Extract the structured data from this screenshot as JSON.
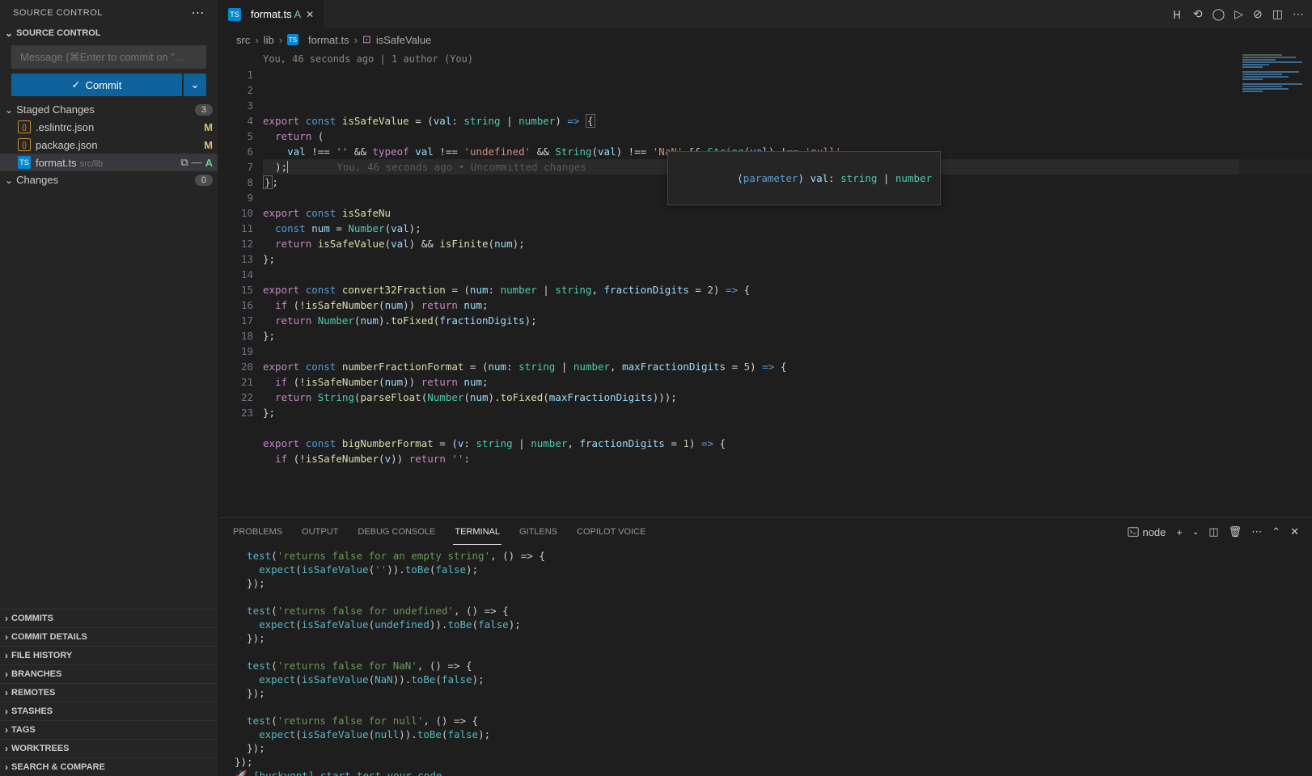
{
  "sidebar": {
    "title": "SOURCE CONTROL",
    "scm_header": "SOURCE CONTROL",
    "message_placeholder": "Message (⌘Enter to commit on \"...",
    "commit_label": "Commit",
    "staged_label": "Staged Changes",
    "staged_count": "3",
    "changes_label": "Changes",
    "changes_count": "0",
    "staged_files": [
      {
        "name": ".eslintrc.json",
        "status": "M",
        "icon": "json"
      },
      {
        "name": "package.json",
        "status": "M",
        "icon": "json"
      },
      {
        "name": "format.ts",
        "path": "src/lib",
        "status": "A",
        "icon": "ts",
        "selected": true
      }
    ],
    "other_sections": [
      "COMMITS",
      "COMMIT DETAILS",
      "FILE HISTORY",
      "BRANCHES",
      "REMOTES",
      "STASHES",
      "TAGS",
      "WORKTREES",
      "SEARCH & COMPARE"
    ]
  },
  "tab": {
    "title": "format.ts",
    "suffix": " A"
  },
  "breadcrumb": {
    "parts": [
      "src",
      "lib",
      "format.ts",
      "isSafeValue"
    ]
  },
  "codelens": "You, 46 seconds ago | 1 author (You)",
  "inline_blame": "You, 46 seconds ago • Uncommitted changes",
  "hover": "(parameter) val: string | number",
  "code_lines": [
    {
      "n": 1,
      "html": "<span class='kw'>export</span> <span class='kw2'>const</span> <span class='fn'>isSafeValue</span> <span class='op'>=</span> <span class='pun'>(</span><span class='var'>val</span><span class='pun'>:</span> <span class='typ'>string</span> <span class='pun'>|</span> <span class='typ'>number</span><span class='pun'>)</span> <span class='kw2'>=&gt;</span> <span class='brace-match'>{</span>"
    },
    {
      "n": 2,
      "html": "  <span class='kw'>return</span> <span class='pun'>(</span>"
    },
    {
      "n": 3,
      "html": "    <span class='var'>val</span> <span class='op'>!==</span> <span class='str'>''</span> <span class='op'>&amp;&amp;</span> <span class='kw'>typeof</span> <span class='var'>val</span> <span class='op'>!==</span> <span class='str'>'undefined'</span> <span class='op'>&amp;&amp;</span> <span class='fn2'>String</span><span class='pun'>(</span><span class='var'>val</span><span class='pun'>)</span> <span class='op'>!==</span> <span class='str'>'NaN'</span> <span class='op'>&amp;&amp;</span> <span class='fn2'>String</span><span class='pun'>(</span><span class='var'>val</span><span class='pun'>)</span> <span class='op'>!==</span> <span class='str'>'null'</span>"
    },
    {
      "n": 4,
      "active": true,
      "html": "  <span class='pun'>);</span><span style='border-left:1px solid #aeafad;'></span>        <span class='inline-blame'>__BLAME__</span>"
    },
    {
      "n": 5,
      "html": "<span class='brace-match'>}</span><span class='pun'>;</span>"
    },
    {
      "n": 6,
      "html": ""
    },
    {
      "n": 7,
      "html": "<span class='kw'>export</span> <span class='kw2'>const</span> <span class='fn'>isSafeNu</span>"
    },
    {
      "n": 8,
      "html": "  <span class='kw2'>const</span> <span class='var'>num</span> <span class='op'>=</span> <span class='fn2'>Number</span><span class='pun'>(</span><span class='var'>val</span><span class='pun'>);</span>"
    },
    {
      "n": 9,
      "html": "  <span class='kw'>return</span> <span class='fn'>isSafeValue</span><span class='pun'>(</span><span class='var'>val</span><span class='pun'>)</span> <span class='op'>&amp;&amp;</span> <span class='fn'>isFinite</span><span class='pun'>(</span><span class='var'>num</span><span class='pun'>);</span>"
    },
    {
      "n": 10,
      "html": "<span class='pun'>};</span>"
    },
    {
      "n": 11,
      "html": ""
    },
    {
      "n": 12,
      "html": "<span class='kw'>export</span> <span class='kw2'>const</span> <span class='fn'>convert32Fraction</span> <span class='op'>=</span> <span class='pun'>(</span><span class='var'>num</span><span class='pun'>:</span> <span class='typ'>number</span> <span class='pun'>|</span> <span class='typ'>string</span><span class='pun'>,</span> <span class='var'>fractionDigits</span> <span class='op'>=</span> <span class='num'>2</span><span class='pun'>)</span> <span class='kw2'>=&gt;</span> <span class='pun'>{</span>"
    },
    {
      "n": 13,
      "html": "  <span class='kw'>if</span> <span class='pun'>(!</span><span class='fn'>isSafeNumber</span><span class='pun'>(</span><span class='var'>num</span><span class='pun'>))</span> <span class='kw'>return</span> <span class='var'>num</span><span class='pun'>;</span>"
    },
    {
      "n": 14,
      "html": "  <span class='kw'>return</span> <span class='fn2'>Number</span><span class='pun'>(</span><span class='var'>num</span><span class='pun'>).</span><span class='fn'>toFixed</span><span class='pun'>(</span><span class='var'>fractionDigits</span><span class='pun'>);</span>"
    },
    {
      "n": 15,
      "html": "<span class='pun'>};</span>"
    },
    {
      "n": 16,
      "html": ""
    },
    {
      "n": 17,
      "html": "<span class='kw'>export</span> <span class='kw2'>const</span> <span class='fn'>numberFractionFormat</span> <span class='op'>=</span> <span class='pun'>(</span><span class='var'>num</span><span class='pun'>:</span> <span class='typ'>string</span> <span class='pun'>|</span> <span class='typ'>number</span><span class='pun'>,</span> <span class='var'>maxFractionDigits</span> <span class='op'>=</span> <span class='num'>5</span><span class='pun'>)</span> <span class='kw2'>=&gt;</span> <span class='pun'>{</span>"
    },
    {
      "n": 18,
      "html": "  <span class='kw'>if</span> <span class='pun'>(!</span><span class='fn'>isSafeNumber</span><span class='pun'>(</span><span class='var'>num</span><span class='pun'>))</span> <span class='kw'>return</span> <span class='var'>num</span><span class='pun'>;</span>"
    },
    {
      "n": 19,
      "html": "  <span class='kw'>return</span> <span class='fn2'>String</span><span class='pun'>(</span><span class='fn'>parseFloat</span><span class='pun'>(</span><span class='fn2'>Number</span><span class='pun'>(</span><span class='var'>num</span><span class='pun'>).</span><span class='fn'>toFixed</span><span class='pun'>(</span><span class='var'>maxFractionDigits</span><span class='pun'>)));</span>"
    },
    {
      "n": 20,
      "html": "<span class='pun'>};</span>"
    },
    {
      "n": 21,
      "html": ""
    },
    {
      "n": 22,
      "html": "<span class='kw'>export</span> <span class='kw2'>const</span> <span class='fn'>bigNumberFormat</span> <span class='op'>=</span> <span class='pun'>(</span><span class='var'>v</span><span class='pun'>:</span> <span class='typ'>string</span> <span class='pun'>|</span> <span class='typ'>number</span><span class='pun'>,</span> <span class='var'>fractionDigits</span> <span class='op'>=</span> <span class='num'>1</span><span class='pun'>)</span> <span class='kw2'>=&gt;</span> <span class='pun'>{</span>"
    },
    {
      "n": 23,
      "html": "  <span class='kw'>if</span> <span class='pun'>(!</span><span class='fn'>isSafeNumber</span><span class='pun'>(</span><span class='var'>v</span><span class='pun'>))</span> <span class='kw'>return</span> <span class='str'>''</span><span class='pun'>:</span>"
    }
  ],
  "panel": {
    "tabs": [
      "PROBLEMS",
      "OUTPUT",
      "DEBUG CONSOLE",
      "TERMINAL",
      "GITLENS",
      "COPILOT VOICE"
    ],
    "active_tab": 3,
    "terminal_label": "node",
    "terminal_lines": [
      "  <span class='t-call'>test</span>(<span class='t-str'>'returns false for an empty string'</span>, () =&gt; {",
      "    <span class='t-call'>expect</span>(<span class='t-call'>isSafeValue</span>(<span class='t-str'>''</span>)).<span class='t-call'>toBe</span>(<span class='t-call'>false</span>);",
      "  });",
      "",
      "  <span class='t-call'>test</span>(<span class='t-str'>'returns false for undefined'</span>, () =&gt; {",
      "    <span class='t-call'>expect</span>(<span class='t-call'>isSafeValue</span>(<span class='t-call'>undefined</span>)).<span class='t-call'>toBe</span>(<span class='t-call'>false</span>);",
      "  });",
      "",
      "  <span class='t-call'>test</span>(<span class='t-str'>'returns false for NaN'</span>, () =&gt; {",
      "    <span class='t-call'>expect</span>(<span class='t-call'>isSafeValue</span>(<span class='t-call'>NaN</span>)).<span class='t-call'>toBe</span>(<span class='t-call'>false</span>);",
      "  });",
      "",
      "  <span class='t-call'>test</span>(<span class='t-str'>'returns false for null'</span>, () =&gt; {",
      "    <span class='t-call'>expect</span>(<span class='t-call'>isSafeValue</span>(<span class='t-call'>null</span>)).<span class='t-call'>toBe</span>(<span class='t-call'>false</span>);",
      "  });",
      "});",
      "🚀 <span class='t-husky'>[huskygpt] start test your code...</span>",
      "🚀"
    ]
  }
}
